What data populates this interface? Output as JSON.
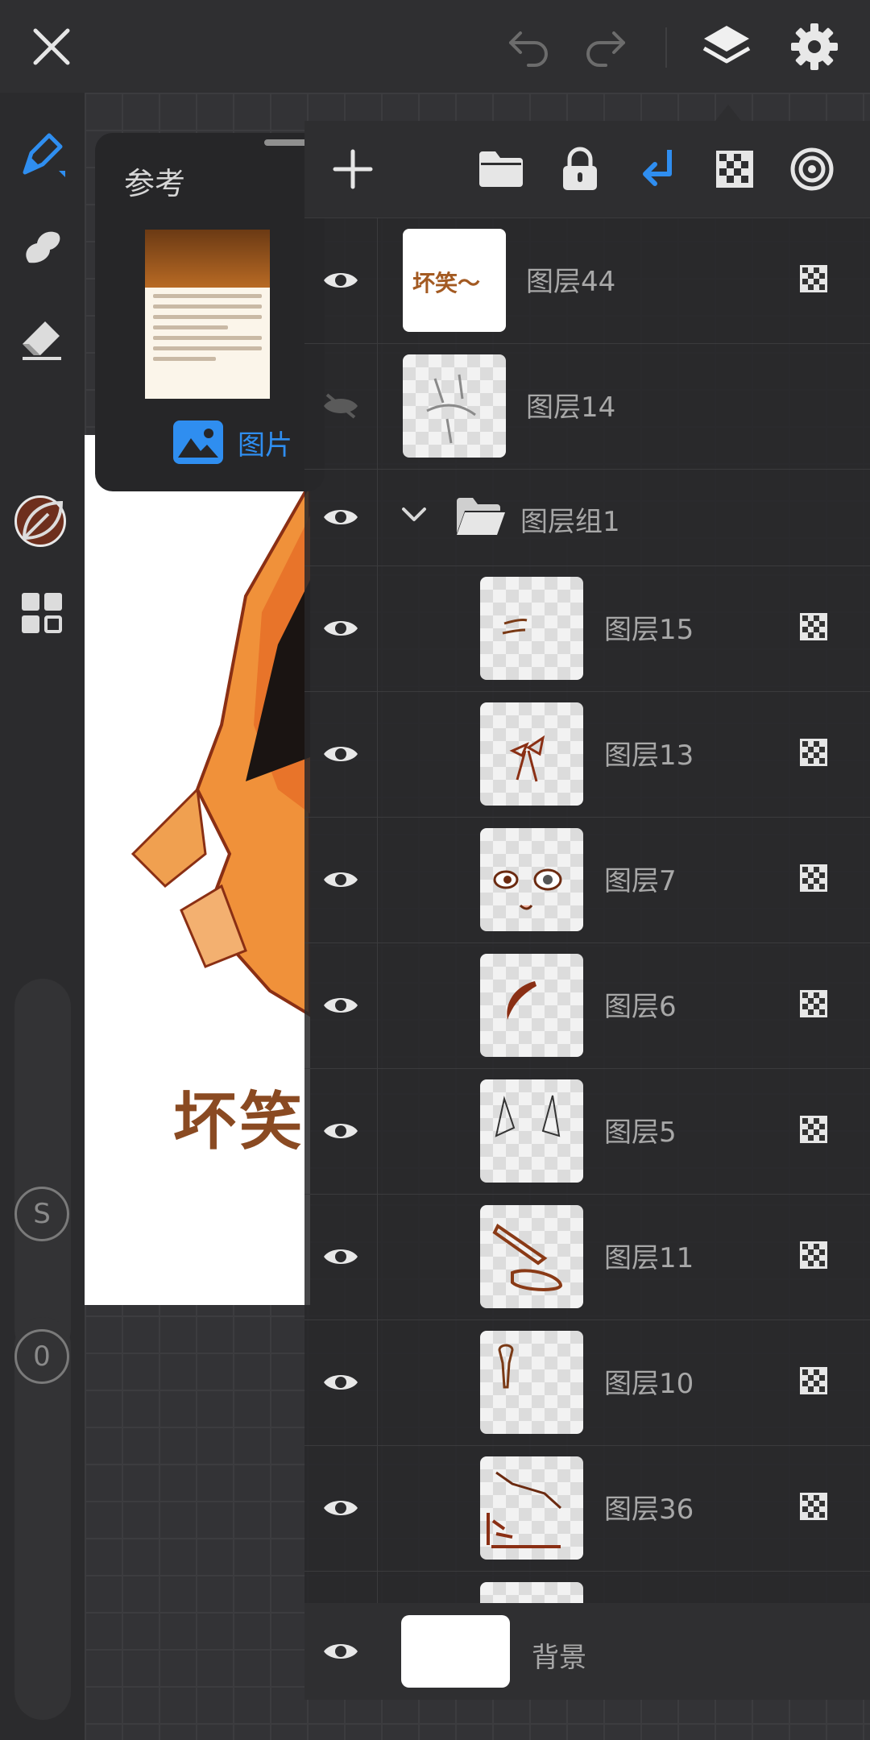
{
  "toolbar": {
    "close": "close-icon",
    "undo": "undo-icon",
    "redo": "redo-icon",
    "layers": "layers-icon",
    "settings": "gear-icon"
  },
  "left_tools": {
    "color": "#6e2f1d",
    "opacity_value": "0",
    "size_knob_label": "S"
  },
  "reference": {
    "title": "参考",
    "image_button_label": "图片"
  },
  "canvas": {
    "caption": "坏笑"
  },
  "layers_panel": {
    "active_tool_color": "#2f8ef0",
    "layers": [
      {
        "name": "图层44",
        "visible": true
      },
      {
        "name": "图层14",
        "visible": false
      },
      {
        "name": "图层组1",
        "visible": true,
        "group": true
      },
      {
        "name": "图层15",
        "visible": true
      },
      {
        "name": "图层13",
        "visible": true
      },
      {
        "name": "图层7",
        "visible": true
      },
      {
        "name": "图层6",
        "visible": true
      },
      {
        "name": "图层5",
        "visible": true
      },
      {
        "name": "图层11",
        "visible": true
      },
      {
        "name": "图层10",
        "visible": true
      },
      {
        "name": "图层36",
        "visible": true
      }
    ],
    "thumb_44_text": "坏笑～",
    "background": {
      "name": "背景",
      "visible": true
    }
  }
}
